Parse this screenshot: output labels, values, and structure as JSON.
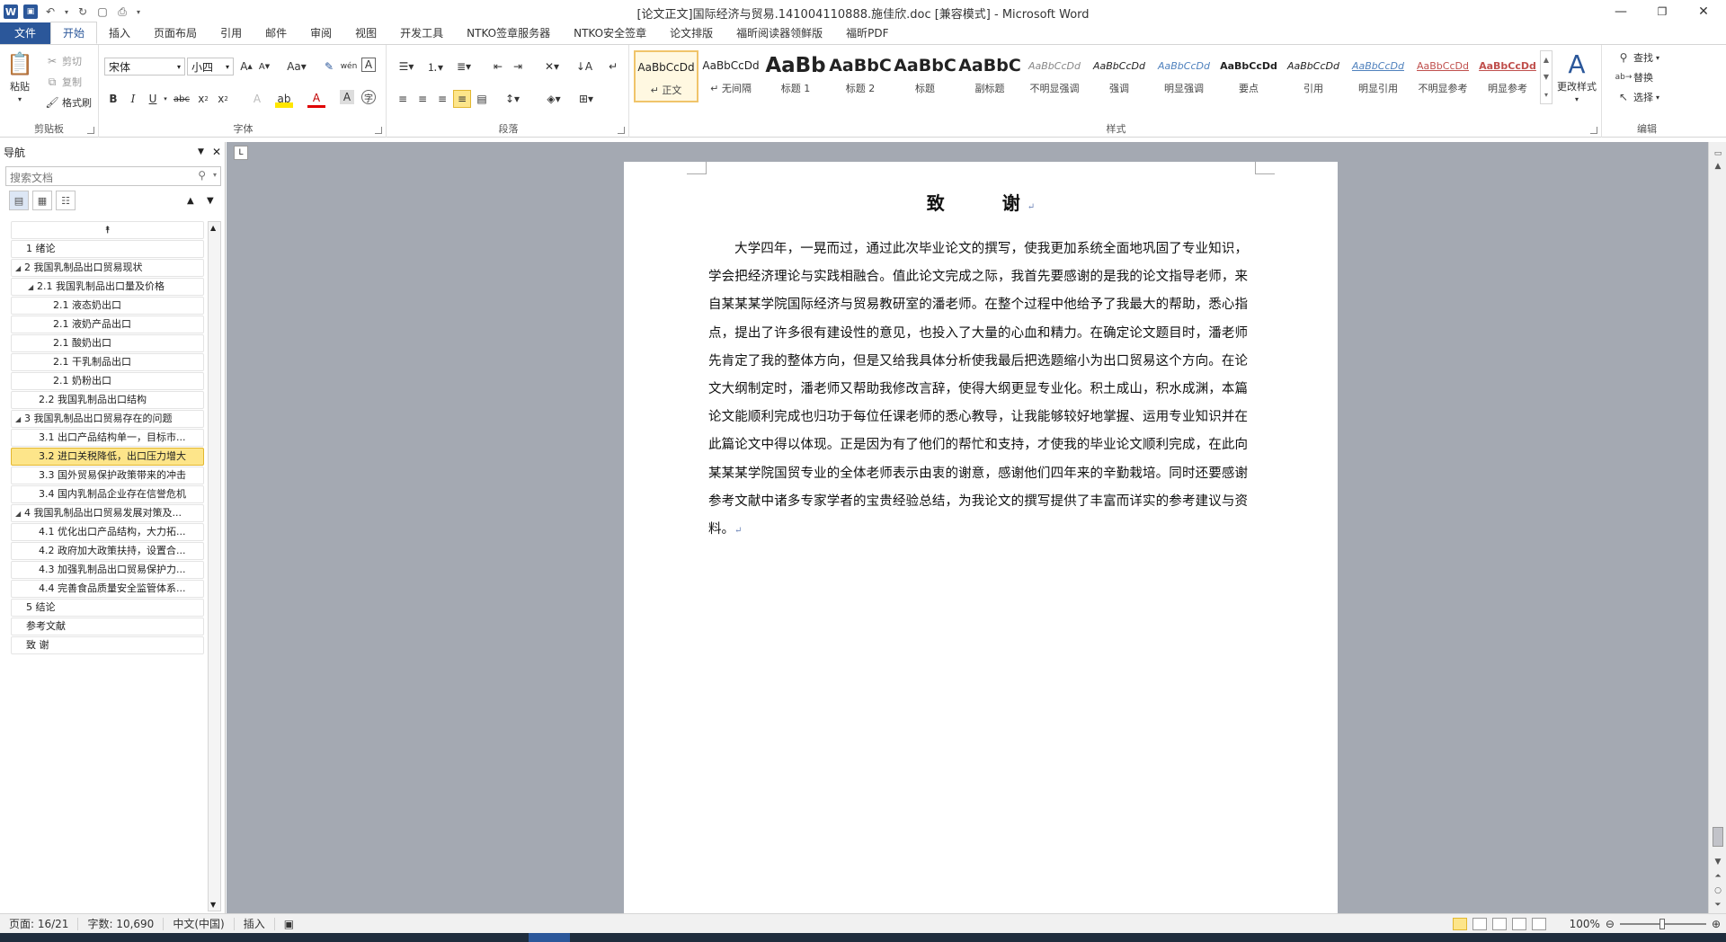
{
  "titlebar": {
    "title": "[论文正文]国际经济与贸易.141004110888.施佳欣.doc [兼容模式] - Microsoft Word",
    "app_icon": "W",
    "minimize": "—",
    "restore": "❐",
    "close": "✕"
  },
  "tabs": [
    "文件",
    "开始",
    "插入",
    "页面布局",
    "引用",
    "邮件",
    "审阅",
    "视图",
    "开发工具",
    "NTKO签章服务器",
    "NTKO安全签章",
    "论文排版",
    "福昕阅读器领鲜版",
    "福昕PDF"
  ],
  "ribbon": {
    "clipboard": {
      "label": "剪贴板",
      "paste": "粘贴",
      "cut": "剪切",
      "copy": "复制",
      "format_painter": "格式刷"
    },
    "font": {
      "label": "字体",
      "font_name": "宋体",
      "font_size": "小四"
    },
    "paragraph": {
      "label": "段落"
    },
    "styles": {
      "label": "样式",
      "change_styles": "更改样式",
      "items": [
        {
          "sample": "AaBbCcDd",
          "name": "↵ 正文"
        },
        {
          "sample": "AaBbCcDd",
          "name": "↵ 无间隔"
        },
        {
          "sample": "AaBb",
          "name": "标题 1"
        },
        {
          "sample": "AaBbC",
          "name": "标题 2"
        },
        {
          "sample": "AaBbC",
          "name": "标题"
        },
        {
          "sample": "AaBbC",
          "name": "副标题"
        },
        {
          "sample": "AaBbCcDd",
          "name": "不明显强调"
        },
        {
          "sample": "AaBbCcDd",
          "name": "强调"
        },
        {
          "sample": "AaBbCcDd",
          "name": "明显强调"
        },
        {
          "sample": "AaBbCcDd",
          "name": "要点"
        },
        {
          "sample": "AaBbCcDd",
          "name": "引用"
        },
        {
          "sample": "AaBbCcDd",
          "name": "明显引用"
        },
        {
          "sample": "AaBbCcDd",
          "name": "不明显参考"
        },
        {
          "sample": "AaBbCcDd",
          "name": "明显参考"
        }
      ]
    },
    "editing": {
      "label": "编辑",
      "find": "查找",
      "replace": "替换",
      "select": "选择"
    }
  },
  "nav": {
    "title": "导航",
    "search_placeholder": "搜索文档",
    "items": [
      {
        "text": "1 绪论"
      },
      {
        "text": "2 我国乳制品出口贸易现状"
      },
      {
        "text": "2.1 我国乳制品出口量及价格"
      },
      {
        "text": "2.1 液态奶出口"
      },
      {
        "text": "2.1 液奶产品出口"
      },
      {
        "text": "2.1 酸奶出口"
      },
      {
        "text": "2.1 干乳制品出口"
      },
      {
        "text": "2.1 奶粉出口"
      },
      {
        "text": "2.2 我国乳制品出口结构"
      },
      {
        "text": "3 我国乳制品出口贸易存在的问题"
      },
      {
        "text": "3.1 出口产品结构单一，目标市..."
      },
      {
        "text": "3.2 进口关税降低，出口压力增大"
      },
      {
        "text": "3.3 国外贸易保护政策带来的冲击"
      },
      {
        "text": "3.4 国内乳制品企业存在信誉危机"
      },
      {
        "text": "4 我国乳制品出口贸易发展对策及..."
      },
      {
        "text": "4.1 优化出口产品结构，大力拓..."
      },
      {
        "text": "4.2 政府加大政策扶持，设置合..."
      },
      {
        "text": "4.3 加强乳制品出口贸易保护力..."
      },
      {
        "text": "4.4 完善食品质量安全监管体系..."
      },
      {
        "text": "5 结论"
      },
      {
        "text": "参考文献"
      },
      {
        "text": "致  谢"
      }
    ]
  },
  "document": {
    "heading": "致　　谢",
    "body": "大学四年，一晃而过，通过此次毕业论文的撰写，使我更加系统全面地巩固了专业知识，学会把经济理论与实践相融合。值此论文完成之际，我首先要感谢的是我的论文指导老师，来自某某某学院国际经济与贸易教研室的潘老师。在整个过程中他给予了我最大的帮助，悉心指点，提出了许多很有建设性的意见，也投入了大量的心血和精力。在确定论文题目时，潘老师先肯定了我的整体方向，但是又给我具体分析使我最后把选题缩小为出口贸易这个方向。在论文大纲制定时，潘老师又帮助我修改言辞，使得大纲更显专业化。积土成山，积水成渊，本篇论文能顺利完成也归功于每位任课老师的悉心教导，让我能够较好地掌握、运用专业知识并在此篇论文中得以体现。正是因为有了他们的帮忙和支持，才使我的毕业论文顺利完成，在此向某某某学院国贸专业的全体老师表示由衷的谢意，感谢他们四年来的辛勤栽培。同时还要感谢参考文献中诸多专家学者的宝贵经验总结，为我论文的撰写提供了丰富而详实的参考建议与资料。"
  },
  "status": {
    "page": "页面: 16/21",
    "words": "字数: 10,690",
    "language": "中文(中国)",
    "mode": "插入",
    "zoom": "100%"
  }
}
